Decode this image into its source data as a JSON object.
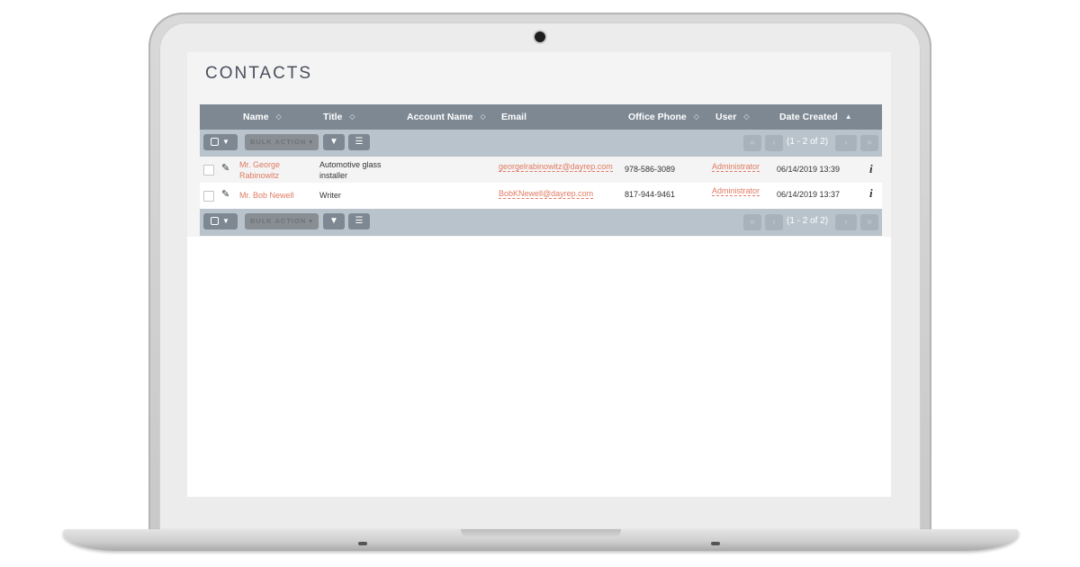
{
  "page": {
    "title": "CONTACTS"
  },
  "table": {
    "columns": [
      "Name",
      "Title",
      "Account Name",
      "Email",
      "Office Phone",
      "User",
      "Date Created"
    ],
    "rows": [
      {
        "name_line1": "Mr. George",
        "name_line2": "Rabinowitz",
        "title_line1": "Automotive glass",
        "title_line2": "installer",
        "account_name": "",
        "email": "georgelrabinowitz@dayrep.com",
        "phone": "978-586-3089",
        "user": "Administrator",
        "date_created": "06/14/2019 13:39"
      },
      {
        "name_line1": "Mr. Bob Newell",
        "name_line2": "",
        "title_line1": "Writer",
        "title_line2": "",
        "account_name": "",
        "email": "BobKNewell@dayrep.com",
        "phone": "817-944-9461",
        "user": "Administrator",
        "date_created": "06/14/2019 13:37"
      }
    ]
  },
  "toolbar": {
    "bulk_action_label": "BULK ACTION",
    "pagination_text": "(1 - 2 of 2)"
  },
  "icons": {
    "sort": "sort-icon",
    "sort_active": "sort-asc-icon",
    "filter": "filter-icon",
    "columns": "column-chooser-icon",
    "edit": "pencil-icon",
    "info": "info-icon"
  },
  "colors": {
    "header_bg": "#7d8893",
    "toolbar_bg": "#b8c3cc",
    "link": "#e07a63"
  }
}
